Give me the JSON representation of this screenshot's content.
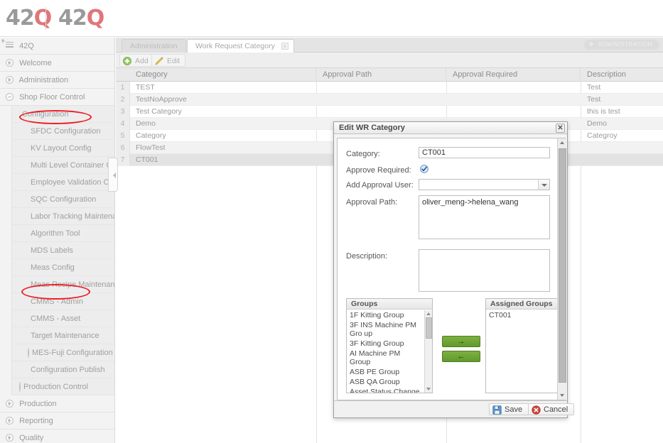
{
  "brand": {
    "prefix": "42",
    "suffix": "Q"
  },
  "sidebar": {
    "root": {
      "label": "42Q",
      "icon": "list-icon"
    },
    "items": [
      {
        "label": "Welcome",
        "icon": "plus-circle-icon",
        "level": 0
      },
      {
        "label": "Administration",
        "icon": "plus-circle-icon",
        "level": 0
      },
      {
        "label": "Shop Floor Control",
        "icon": "minus-circle-icon",
        "level": 0
      }
    ],
    "sub_items": [
      {
        "label": "Configuration",
        "icon": "minus-small-icon",
        "highlighted": true
      },
      {
        "label": "SFDC Configuration",
        "icon": "folder-icon"
      },
      {
        "label": "KV Layout Config",
        "icon": "folder-icon"
      },
      {
        "label": "Multi Level Container Conf",
        "icon": "folder-icon"
      },
      {
        "label": "Employee Validation Confi",
        "icon": "folder-icon"
      },
      {
        "label": "SQC Configuration",
        "icon": "folder-icon"
      },
      {
        "label": "Labor Tracking Maintenanc",
        "icon": "folder-icon"
      },
      {
        "label": "Algorithm Tool",
        "icon": "folder-icon"
      },
      {
        "label": "MDS Labels",
        "icon": "folder-icon"
      },
      {
        "label": "Meas Config",
        "icon": "folder-icon"
      },
      {
        "label": "Meas Recipe Maintenance",
        "icon": "folder-icon"
      },
      {
        "label": "CMMS - Admin",
        "icon": "folder-icon",
        "highlighted": true
      },
      {
        "label": "CMMS - Asset",
        "icon": "folder-icon"
      },
      {
        "label": "Target Maintenance",
        "icon": "folder-icon"
      },
      {
        "label": "MES-Fuji Configuration",
        "icon": "plus-circle-icon"
      },
      {
        "label": "Configuration Publish",
        "icon": "folder-icon"
      },
      {
        "label": "Production Control",
        "icon": "plus-circle-icon"
      }
    ],
    "bottom_items": [
      {
        "label": "Production",
        "icon": "plus-circle-icon"
      },
      {
        "label": "Reporting",
        "icon": "plus-circle-icon"
      },
      {
        "label": "Quality",
        "icon": "plus-circle-icon"
      }
    ],
    "collapse_handle": "collapse-sidebar-handle"
  },
  "tabs": [
    {
      "label": "Administration",
      "active": false,
      "closable": false
    },
    {
      "label": "Work Request Category",
      "active": true,
      "closable": true,
      "close_glyph": "×"
    }
  ],
  "admin_badge": {
    "label": "ADMINISTRATION",
    "icon": "move-icon",
    "glyph": "✥"
  },
  "toolbar": {
    "add_label": "Add",
    "edit_label": "Edit"
  },
  "grid": {
    "columns": [
      "Category",
      "Approval Path",
      "Approval Required",
      "Description"
    ],
    "rows": [
      {
        "n": "1",
        "category": "TEST",
        "approval_path": "",
        "approval_required": "",
        "description": "Test"
      },
      {
        "n": "2",
        "category": "TestNoApprove",
        "approval_path": "",
        "approval_required": "",
        "description": "Test"
      },
      {
        "n": "3",
        "category": "Test Category",
        "approval_path": "",
        "approval_required": "",
        "description": "this is test"
      },
      {
        "n": "4",
        "category": "Demo",
        "approval_path": "",
        "approval_required": "",
        "description": "Demo"
      },
      {
        "n": "5",
        "category": "Category",
        "approval_path": "",
        "approval_required": "",
        "description": "Categroy"
      },
      {
        "n": "6",
        "category": "FlowTest",
        "approval_path": "",
        "approval_required": "",
        "description": ""
      },
      {
        "n": "7",
        "category": "CT001",
        "approval_path": "",
        "approval_required": "",
        "description": ""
      }
    ]
  },
  "modal": {
    "title": "Edit WR Category",
    "close_glyph": "✕",
    "fields": {
      "category_label": "Category:",
      "category_value": "CT001",
      "approve_required_label": "Approve Required:",
      "approve_required_checked": true,
      "add_approval_user_label": "Add Approval User:",
      "add_approval_user_value": "",
      "approval_path_label": "Approval Path:",
      "approval_path_value": "oliver_meng->helena_wang",
      "description_label": "Description:",
      "description_value": ""
    },
    "groups_panel": {
      "title": "Groups",
      "items": [
        "1F Kitting Group",
        "3F INS Machine PM Gro up",
        "3F Kitting Group",
        "AI Machine PM Group",
        "ASB PE Group",
        "ASB QA Group",
        "Asset Status Change Gr oup"
      ]
    },
    "assigned_panel": {
      "title": "Assigned Groups",
      "items": [
        "CT001"
      ]
    },
    "transfer": {
      "right_glyph": "→",
      "left_glyph": "←"
    },
    "footer": {
      "save_label": "Save",
      "cancel_label": "Cancel"
    }
  },
  "colors": {
    "accent_red": "#e0767a",
    "annotation_red": "#ee1c24",
    "green_button": "#63992c",
    "page_bg": "#e4e4e4"
  }
}
